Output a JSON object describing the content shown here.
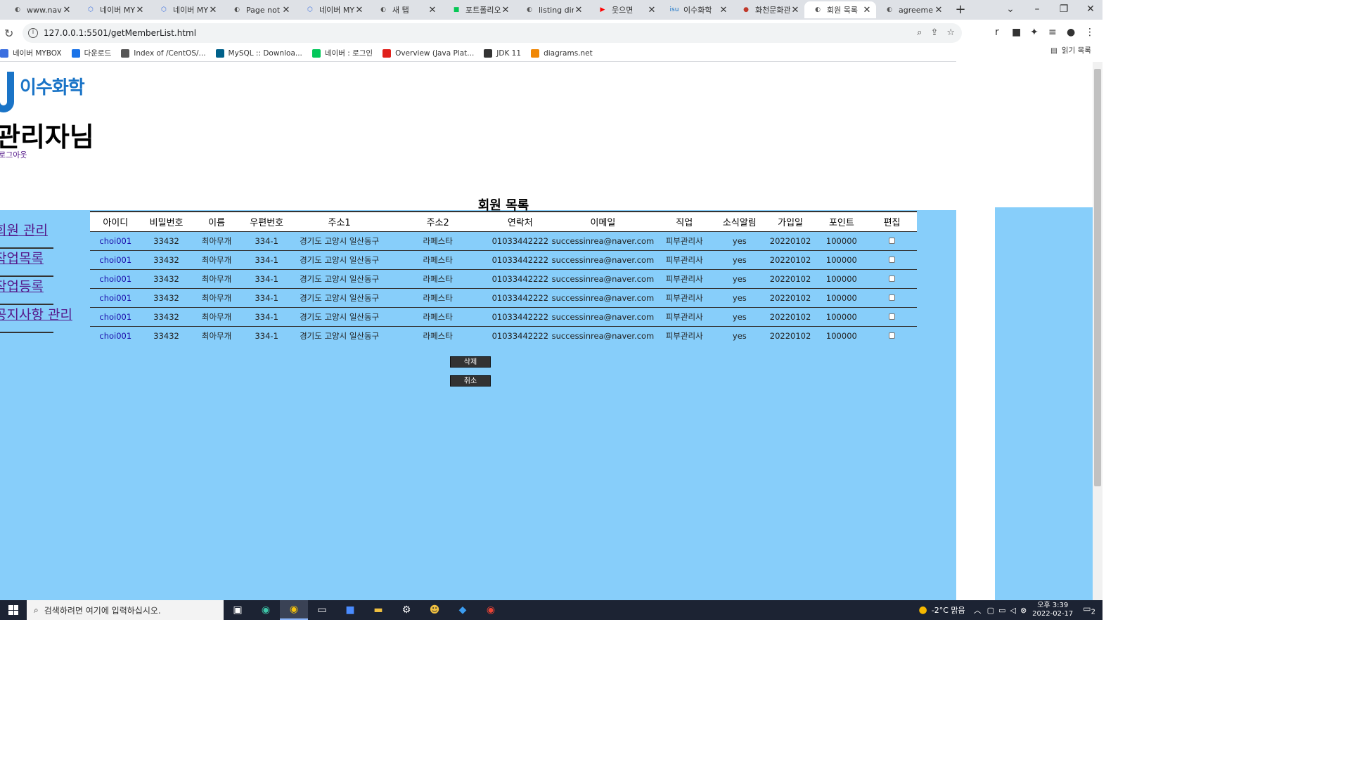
{
  "browser": {
    "tabs": [
      {
        "title": "www.naver.",
        "icon": "globe-icon",
        "active": false
      },
      {
        "title": "네이버 MYBOX",
        "icon": "mybox-icon",
        "active": false
      },
      {
        "title": "네이버 MYBOX",
        "icon": "mybox-icon",
        "active": false
      },
      {
        "title": "Page not fo",
        "icon": "globe-icon",
        "active": false
      },
      {
        "title": "네이버 MYBOX",
        "icon": "mybox-icon",
        "active": false
      },
      {
        "title": "새 탭",
        "icon": "globe-icon",
        "active": false
      },
      {
        "title": "포트폴리오",
        "icon": "line-icon",
        "active": false
      },
      {
        "title": "listing direc",
        "icon": "globe-icon",
        "active": false
      },
      {
        "title": "웃으면",
        "icon": "youtube-icon",
        "active": false
      },
      {
        "title": "이수화학",
        "icon": "isu-icon",
        "active": false
      },
      {
        "title": "화천문화관",
        "icon": "site-icon",
        "active": false
      },
      {
        "title": "회원 목록",
        "icon": "globe-icon",
        "active": true
      },
      {
        "title": "agreement",
        "icon": "globe-icon",
        "active": false
      }
    ],
    "url": "127.0.0.1:5501/getMemberList.html",
    "bookmarks": [
      {
        "label": "네이버 MYBOX",
        "icon": "mybox-icon"
      },
      {
        "label": "다운로드",
        "icon": "download-icon"
      },
      {
        "label": "Index of /CentOS/...",
        "icon": "globe-icon"
      },
      {
        "label": "MySQL :: Downloa...",
        "icon": "mysql-icon"
      },
      {
        "label": "네이버 : 로그인",
        "icon": "naver-icon"
      },
      {
        "label": "Overview (Java Plat...",
        "icon": "oracle-icon"
      },
      {
        "label": "JDK 11",
        "icon": "java-icon"
      },
      {
        "label": "diagrams.net",
        "icon": "diagrams-icon"
      }
    ],
    "reading_list": "읽기 목록"
  },
  "page": {
    "logo_text": "이수화학",
    "admin_name": "관리자님",
    "logout": "로그아웃",
    "list_title": "회원 목록",
    "side_nav": [
      "회원 관리",
      "작업목록",
      "작업등록",
      "공지사항 관리"
    ],
    "columns": [
      "아이디",
      "비밀번호",
      "이름",
      "우편번호",
      "주소1",
      "주소2",
      "연락처",
      "이메일",
      "직업",
      "소식알림",
      "가입일",
      "포인트",
      "편집"
    ],
    "rows": [
      [
        "choi001",
        "33432",
        "최아무개",
        "334-1",
        "경기도 고양시 일산동구",
        "라페스타",
        "01033442222",
        "successinrea@naver.com",
        "피부관리사",
        "yes",
        "20220102",
        "100000"
      ],
      [
        "choi001",
        "33432",
        "최아무개",
        "334-1",
        "경기도 고양시 일산동구",
        "라페스타",
        "01033442222",
        "successinrea@naver.com",
        "피부관리사",
        "yes",
        "20220102",
        "100000"
      ],
      [
        "choi001",
        "33432",
        "최아무개",
        "334-1",
        "경기도 고양시 일산동구",
        "라페스타",
        "01033442222",
        "successinrea@naver.com",
        "피부관리사",
        "yes",
        "20220102",
        "100000"
      ],
      [
        "choi001",
        "33432",
        "최아무개",
        "334-1",
        "경기도 고양시 일산동구",
        "라페스타",
        "01033442222",
        "successinrea@naver.com",
        "피부관리사",
        "yes",
        "20220102",
        "100000"
      ],
      [
        "choi001",
        "33432",
        "최아무개",
        "334-1",
        "경기도 고양시 일산동구",
        "라페스타",
        "01033442222",
        "successinrea@naver.com",
        "피부관리사",
        "yes",
        "20220102",
        "100000"
      ],
      [
        "choi001",
        "33432",
        "최아무개",
        "334-1",
        "경기도 고양시 일산동구",
        "라페스타",
        "01033442222",
        "successinrea@naver.com",
        "피부관리사",
        "yes",
        "20220102",
        "100000"
      ]
    ],
    "delete_button": "삭제",
    "cancel_button": "취소",
    "bg_color": "#87cefa"
  },
  "taskbar": {
    "search_placeholder": "검색하려면 여기에 입력하십시오.",
    "weather": "-2°C 맑음",
    "time": "오후 3:39",
    "date": "2022-02-17",
    "notification_count": "2"
  }
}
